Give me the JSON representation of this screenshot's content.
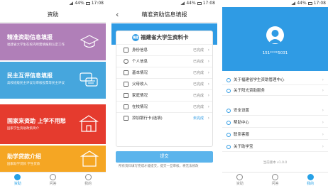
{
  "status": {
    "battery": "44%",
    "time": "17:08"
  },
  "s1": {
    "title": "资助",
    "cards": [
      {
        "title": "精准资助信息填报",
        "subtitle": "福建省大学生在校内所需填报和认定工作"
      },
      {
        "title": "民主互评信息填报",
        "subtitle": "高校班级民主评议与审核投票等民主评议"
      },
      {
        "title": "国家来资助 上学不用愁",
        "subtitle": "国家学生资助政策简介"
      },
      {
        "title": "助学贷款介绍",
        "subtitle": "国家助学贷款 学生贷款"
      }
    ],
    "tabs": [
      "资助",
      "问答",
      "我的"
    ]
  },
  "s2": {
    "back": "‹",
    "title": "精准资助信息填报",
    "badge": "福建",
    "card_title": "福建省大学生资料卡",
    "rows": [
      {
        "label": "身份信息",
        "status": "已完成"
      },
      {
        "label": "个人信息",
        "status": "已完成"
      },
      {
        "label": "基本情况",
        "status": "已完成"
      },
      {
        "label": "父母收入",
        "status": "已完成"
      },
      {
        "label": "家庭情况",
        "status": "已完成"
      },
      {
        "label": "在校情况",
        "status": "已完成"
      },
      {
        "label": "添加银行卡(选填)",
        "status": "未完成"
      }
    ],
    "submit": "提交",
    "hint": "所有资料填写完成才能提交，提交一旦审核，将无法修改"
  },
  "s3": {
    "phone": "151****5031",
    "menu": [
      "关于福建省学生资助管理中心",
      "关于阳光资助服务",
      "安全设置",
      "帮助中心",
      "联系客服",
      "关于助学宝"
    ],
    "version": "当前版本 v1.0.0",
    "tabs": [
      "资助",
      "问答",
      "我的"
    ]
  },
  "colors": {
    "blue": "#2f9be4",
    "purple": "#b07fb8",
    "red": "#e53b2e",
    "orange": "#f5a623"
  }
}
